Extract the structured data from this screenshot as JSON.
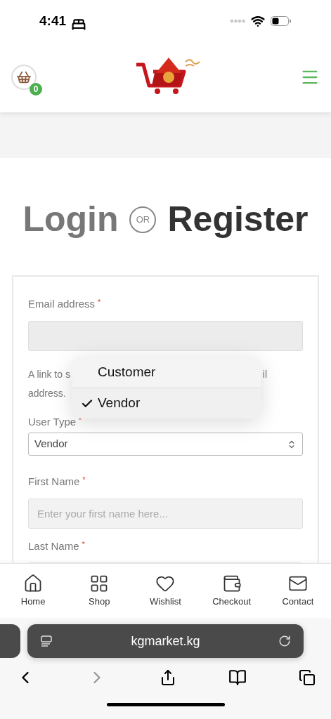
{
  "status_bar": {
    "time": "4:41"
  },
  "header": {
    "cart_count": "0"
  },
  "heading": {
    "login": "Login",
    "or": "OR",
    "register": "Register"
  },
  "form": {
    "email": {
      "label": "Email address",
      "required_mark": "*"
    },
    "note": {
      "line1_start": "A link to s",
      "line1_end": "il",
      "line2": "address."
    },
    "user_type": {
      "label": "User Type",
      "required_mark": "*",
      "value": "Vendor"
    },
    "first_name": {
      "label": "First Name",
      "required_mark": "*",
      "placeholder": "Enter your first name here..."
    },
    "last_name": {
      "label": "Last Name",
      "required_mark": "*"
    }
  },
  "dropdown": {
    "options": [
      {
        "label": "Customer",
        "selected": false
      },
      {
        "label": "Vendor",
        "selected": true
      }
    ]
  },
  "bottom_nav": [
    {
      "kind": "home",
      "label": "Home"
    },
    {
      "kind": "shop",
      "label": "Shop"
    },
    {
      "kind": "wishlist",
      "label": "Wishlist"
    },
    {
      "kind": "checkout",
      "label": "Checkout"
    },
    {
      "kind": "contact",
      "label": "Contact"
    }
  ],
  "browser": {
    "url": "kgmarket.kg"
  }
}
